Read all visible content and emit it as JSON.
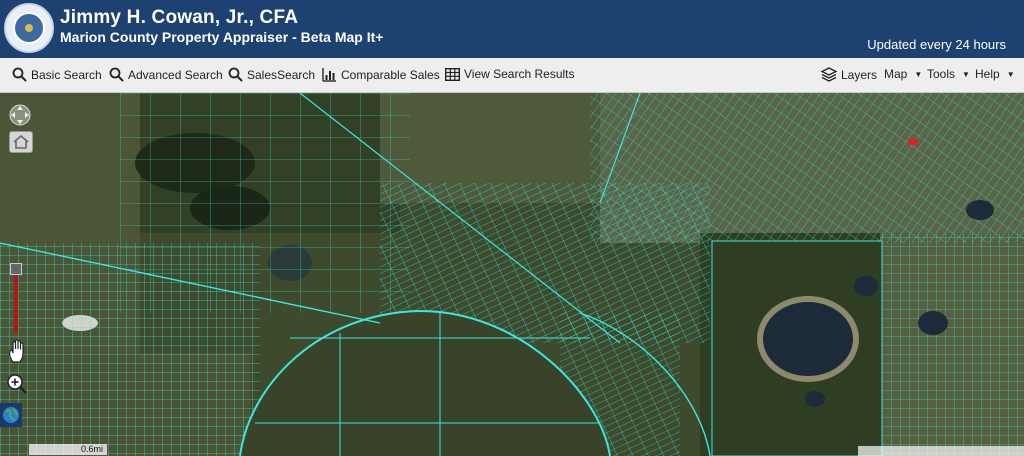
{
  "header": {
    "title": "Jimmy H. Cowan, Jr., CFA",
    "subtitle": "Marion County Property Appraiser - Beta Map It+",
    "updated": "Updated every 24 hours"
  },
  "toolbar": {
    "basic_search": "Basic Search",
    "advanced_search": "Advanced Search",
    "sales_search": "SalesSearch",
    "comparable_sales": "Comparable Sales",
    "view_search_results": "View Search Results",
    "layers": "Layers",
    "map": "Map",
    "tools": "Tools",
    "help": "Help"
  },
  "map": {
    "scale_label": "0.6mi"
  },
  "colors": {
    "header_bg": "#1d4170",
    "parcel_lines": "#3ee6e0",
    "toolbar_bg": "#eeeeee"
  }
}
